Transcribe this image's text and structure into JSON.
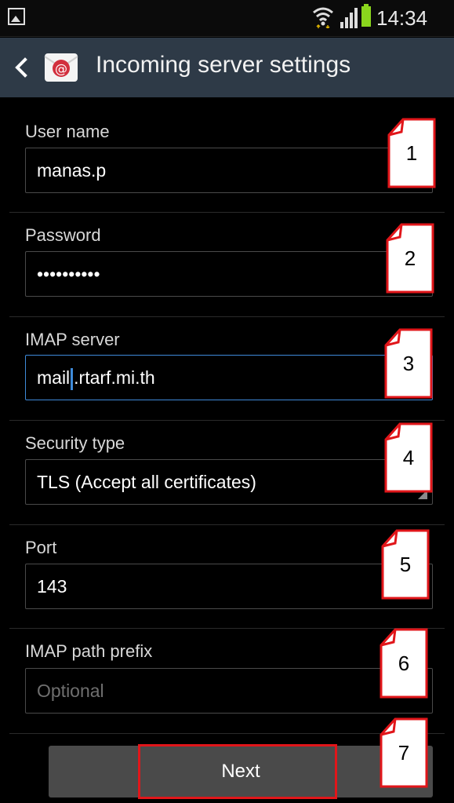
{
  "status_bar": {
    "time": "14:34"
  },
  "action_bar": {
    "title": "Incoming server settings",
    "back_icon": "chevron-left-icon",
    "app_icon": "email-at-icon"
  },
  "form": {
    "username": {
      "label": "User name",
      "value": "manas.p"
    },
    "password": {
      "label": "Password",
      "value": "••••••••••"
    },
    "imap_server": {
      "label": "IMAP server",
      "value_before_caret": "mail",
      "value_after_caret": ".rtarf.mi.th"
    },
    "security_type": {
      "label": "Security type",
      "value": "TLS (Accept all certificates)"
    },
    "port": {
      "label": "Port",
      "value": "143"
    },
    "imap_path_prefix": {
      "label": "IMAP path prefix",
      "placeholder": "Optional"
    }
  },
  "next_button": {
    "label": "Next"
  },
  "callouts": [
    "1",
    "2",
    "3",
    "4",
    "5",
    "6",
    "7"
  ],
  "colors": {
    "callout_border": "#e1161a",
    "focus": "#3e8ad9",
    "action_bar": "#2e3a47",
    "battery": "#8ad61d"
  }
}
